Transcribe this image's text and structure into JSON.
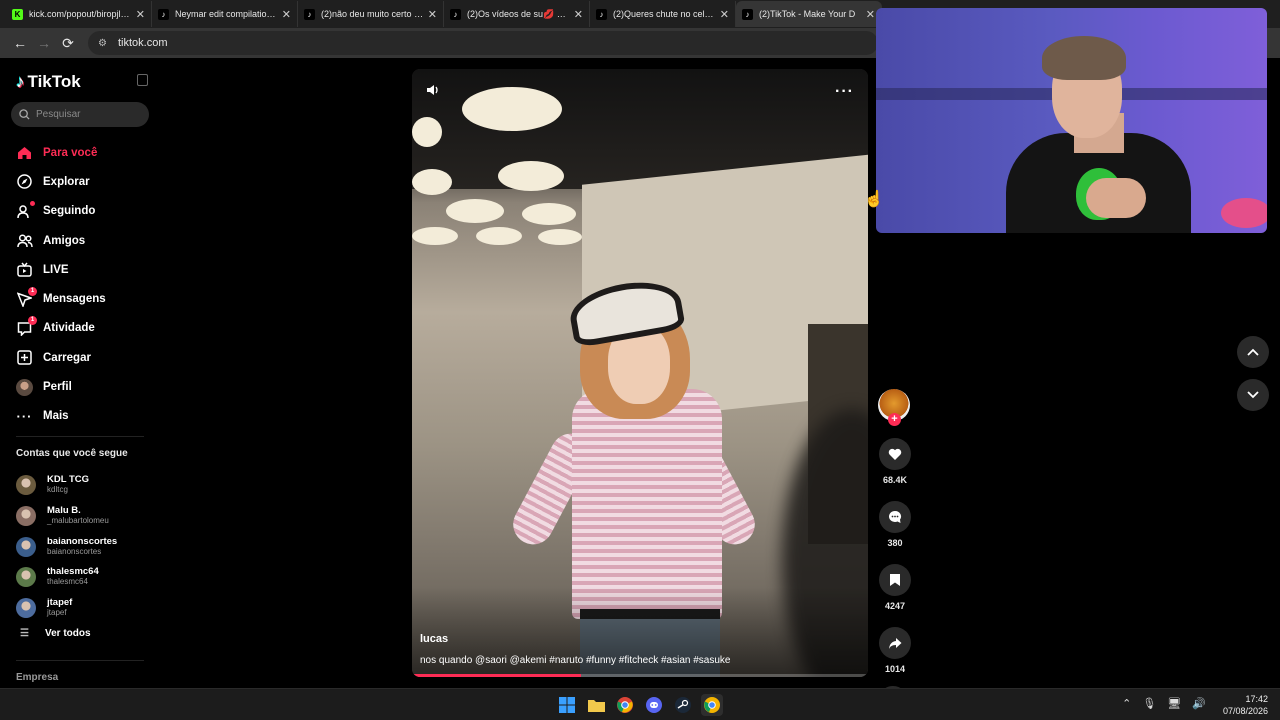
{
  "browser": {
    "tabs": [
      {
        "title": "kick.com/popout/biropjl/ch",
        "favicon": "kick",
        "active": false
      },
      {
        "title": "Neymar edit compilation —",
        "favicon": "tiktok",
        "active": false
      },
      {
        "title": "(2)não deu muito certo 🥲🤎",
        "favicon": "tiktok",
        "active": false
      },
      {
        "title": "(2)Os vídeos de su💋 🍸 ☺",
        "favicon": "tiktok",
        "active": false
      },
      {
        "title": "(2)Queres chute no celular",
        "favicon": "tiktok",
        "active": false
      },
      {
        "title": "(2)TikTok - Make Your D",
        "favicon": "tiktok",
        "active": true
      }
    ],
    "url": "tiktok.com"
  },
  "sidebar": {
    "brand": "TikTok",
    "search_placeholder": "Pesquisar",
    "menu": [
      {
        "label": "Para você",
        "icon": "home-icon",
        "active": true
      },
      {
        "label": "Explorar",
        "icon": "compass-icon"
      },
      {
        "label": "Seguindo",
        "icon": "following-icon",
        "dot": true
      },
      {
        "label": "Amigos",
        "icon": "friends-icon"
      },
      {
        "label": "LIVE",
        "icon": "live-icon"
      },
      {
        "label": "Mensagens",
        "icon": "messages-icon",
        "badge": "1"
      },
      {
        "label": "Atividade",
        "icon": "activity-icon",
        "badge": "1"
      },
      {
        "label": "Carregar",
        "icon": "upload-icon"
      },
      {
        "label": "Perfil",
        "icon": "profile-avatar"
      },
      {
        "label": "Mais",
        "icon": "more-icon"
      }
    ],
    "following_title": "Contas que você segue",
    "following": [
      {
        "name": "KDL TCG",
        "handle": "kdltcg",
        "color": "#6b5b3e"
      },
      {
        "name": "Malu B.",
        "handle": "_malubartolomeu",
        "color": "#8a6e64"
      },
      {
        "name": "baianonscortes",
        "handle": "baianonscortes",
        "color": "#3b5e8c"
      },
      {
        "name": "thalesmc64",
        "handle": "thalesmc64",
        "color": "#5c7a4a"
      },
      {
        "name": "jtapef",
        "handle": "jtapef",
        "color": "#4d6c9e"
      }
    ],
    "see_all": "Ver todos",
    "company": "Empresa"
  },
  "video": {
    "username": "lucas",
    "caption": "nos quando @saori @akemi #naruto #funny #fitcheck #asian #sasuke",
    "progress": 0.37
  },
  "actions": {
    "likes": "68.4K",
    "comments": "380",
    "saves": "4247",
    "shares": "1014"
  },
  "taskbar": {
    "time": "17:42",
    "date": "07/08/2026"
  },
  "colors": {
    "accent": "#fe2c55"
  }
}
